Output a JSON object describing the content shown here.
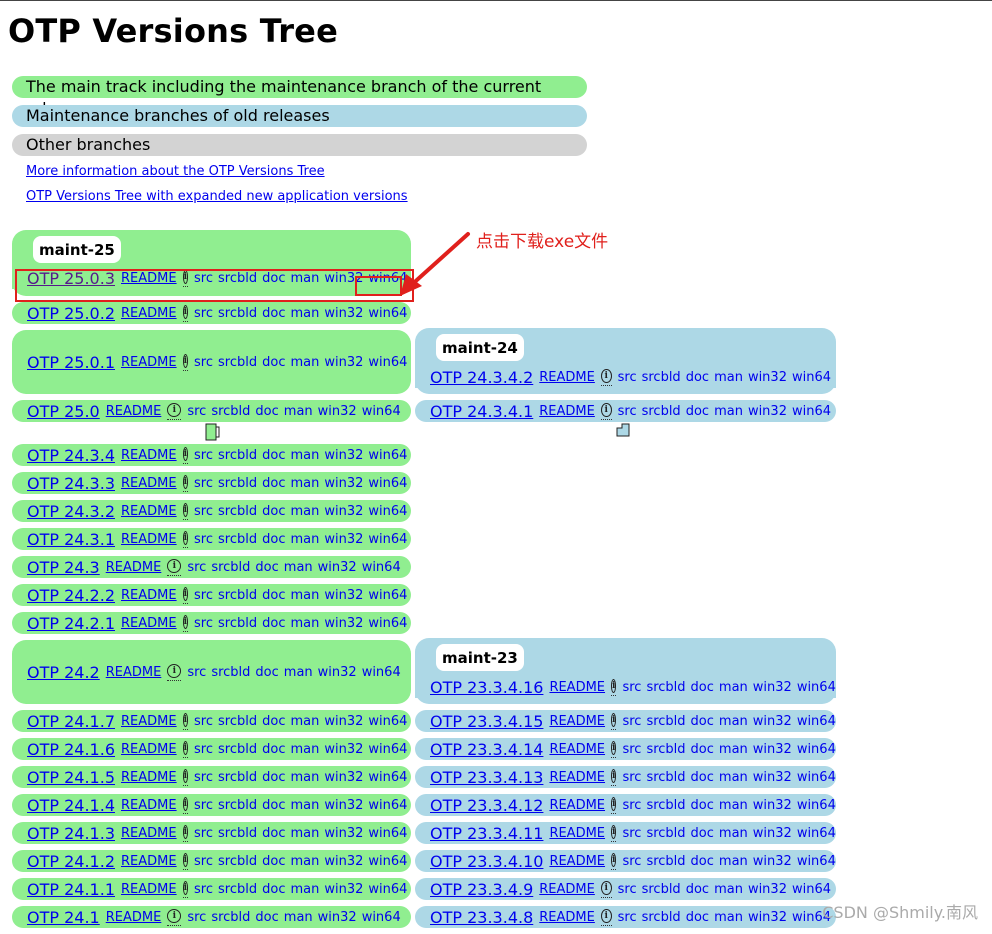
{
  "page": {
    "title": "OTP Versions Tree",
    "legend": {
      "main": "The main track including the maintenance branch of the current release",
      "old": "Maintenance branches of old releases",
      "other": "Other branches"
    },
    "links": {
      "more_info": "More information about the OTP Versions Tree",
      "expanded": "OTP Versions Tree with expanded new application versions"
    },
    "readme_label": "README",
    "downloads": [
      "src",
      "srcbld",
      "doc",
      "man",
      "win32",
      "win64"
    ],
    "colors": {
      "main": "#90ee90",
      "old": "#add8e6",
      "other": "#d3d3d3",
      "link": "#0000ee",
      "annotation": "#e0201c"
    }
  },
  "branches": {
    "maint25": {
      "label": "maint-25",
      "first": "OTP 25.0.3",
      "rows": [
        "OTP 25.0.2"
      ]
    },
    "main_a": {
      "box": "OTP 25.0.1",
      "rows": [
        "OTP 25.0"
      ]
    },
    "main_b": {
      "rows": [
        "OTP 24.3.4",
        "OTP 24.3.3",
        "OTP 24.3.2",
        "OTP 24.3.1",
        "OTP 24.3",
        "OTP 24.2.2",
        "OTP 24.2.1"
      ]
    },
    "main_c": {
      "box": "OTP 24.2",
      "rows": [
        "OTP 24.1.7",
        "OTP 24.1.6",
        "OTP 24.1.5",
        "OTP 24.1.4",
        "OTP 24.1.3",
        "OTP 24.1.2",
        "OTP 24.1.1",
        "OTP 24.1"
      ]
    },
    "maint24": {
      "label": "maint-24",
      "first": "OTP 24.3.4.2",
      "rows": [
        "OTP 24.3.4.1"
      ]
    },
    "maint23": {
      "label": "maint-23",
      "first": "OTP 23.3.4.16",
      "rows": [
        "OTP 23.3.4.15",
        "OTP 23.3.4.14",
        "OTP 23.3.4.13",
        "OTP 23.3.4.12",
        "OTP 23.3.4.11",
        "OTP 23.3.4.10",
        "OTP 23.3.4.9",
        "OTP 23.3.4.8"
      ]
    }
  },
  "annotation": {
    "text": "点击下载exe文件"
  },
  "watermark": "CSDN @Shmily.南风"
}
